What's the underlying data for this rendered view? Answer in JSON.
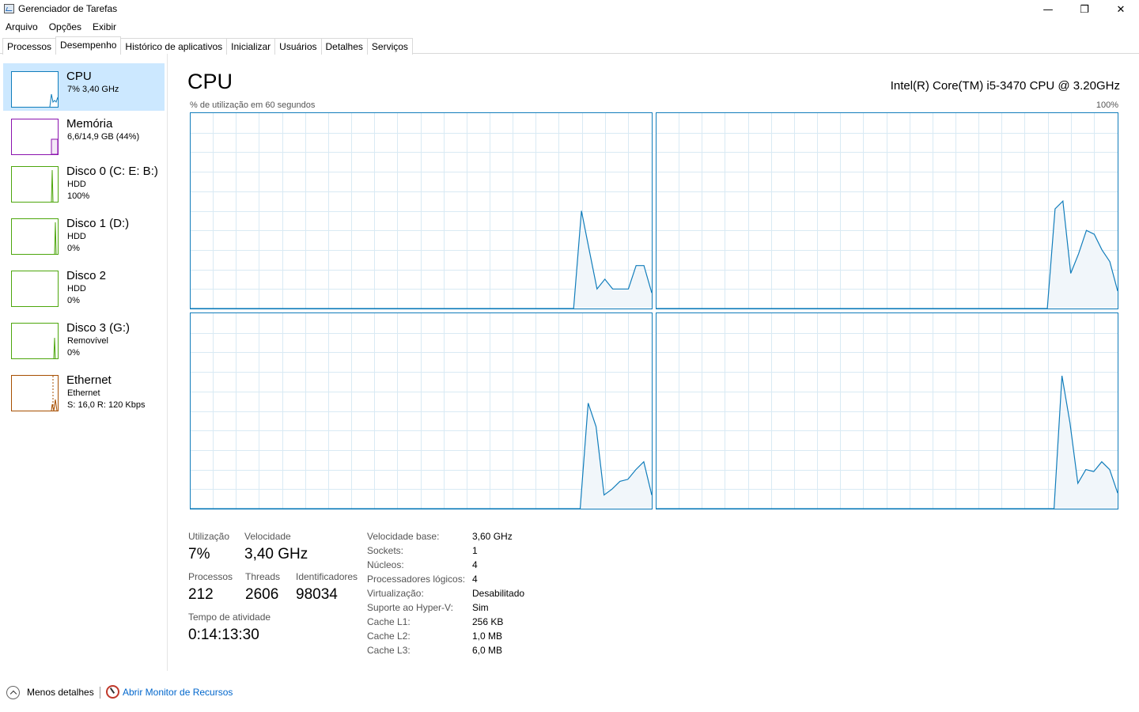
{
  "window": {
    "title": "Gerenciador de Tarefas",
    "minimize_glyph": "—",
    "maximize_glyph": "❐",
    "close_glyph": "✕"
  },
  "menu": [
    "Arquivo",
    "Opções",
    "Exibir"
  ],
  "tabs": [
    "Processos",
    "Desempenho",
    "Histórico de aplicativos",
    "Inicializar",
    "Usuários",
    "Detalhes",
    "Serviços"
  ],
  "active_tab": "Desempenho",
  "sidebar": [
    {
      "title": "CPU",
      "line1": "7% 3,40 GHz",
      "line2": "",
      "color": "#117dbb",
      "selected": true
    },
    {
      "title": "Memória",
      "line1": "6,6/14,9 GB (44%)",
      "line2": "",
      "color": "#8b12ae",
      "selected": false
    },
    {
      "title": "Disco 0 (C: E: B:)",
      "line1": "HDD",
      "line2": "100%",
      "color": "#4da60c",
      "selected": false
    },
    {
      "title": "Disco 1 (D:)",
      "line1": "HDD",
      "line2": "0%",
      "color": "#4da60c",
      "selected": false
    },
    {
      "title": "Disco 2",
      "line1": "HDD",
      "line2": "0%",
      "color": "#4da60c",
      "selected": false
    },
    {
      "title": "Disco 3 (G:)",
      "line1": "Removível",
      "line2": "0%",
      "color": "#4da60c",
      "selected": false
    },
    {
      "title": "Ethernet",
      "line1": "Ethernet",
      "line2": "S: 16,0  R: 120 Kbps",
      "color": "#a74f01",
      "selected": false
    }
  ],
  "main": {
    "title": "CPU",
    "model": "Intel(R) Core(TM) i5-3470 CPU @ 3.20GHz",
    "graph_caption": "% de utilização em 60 segundos",
    "graph_max": "100%"
  },
  "cores_utilization_pct": [
    [
      0,
      0,
      0,
      0,
      0,
      0,
      0,
      0,
      0,
      0,
      0,
      0,
      0,
      0,
      0,
      0,
      0,
      0,
      0,
      0,
      0,
      0,
      0,
      0,
      0,
      0,
      0,
      0,
      0,
      0,
      0,
      0,
      0,
      0,
      0,
      0,
      0,
      0,
      0,
      0,
      0,
      0,
      0,
      0,
      0,
      0,
      0,
      0,
      0,
      0,
      50,
      30,
      10,
      15,
      10,
      10,
      10,
      22,
      22,
      8
    ],
    [
      0,
      0,
      0,
      0,
      0,
      0,
      0,
      0,
      0,
      0,
      0,
      0,
      0,
      0,
      0,
      0,
      0,
      0,
      0,
      0,
      0,
      0,
      0,
      0,
      0,
      0,
      0,
      0,
      0,
      0,
      0,
      0,
      0,
      0,
      0,
      0,
      0,
      0,
      0,
      0,
      0,
      0,
      0,
      0,
      0,
      0,
      0,
      0,
      0,
      0,
      0,
      51,
      55,
      18,
      28,
      40,
      38,
      30,
      24,
      9
    ],
    [
      0,
      0,
      0,
      0,
      0,
      0,
      0,
      0,
      0,
      0,
      0,
      0,
      0,
      0,
      0,
      0,
      0,
      0,
      0,
      0,
      0,
      0,
      0,
      0,
      0,
      0,
      0,
      0,
      0,
      0,
      0,
      0,
      0,
      0,
      0,
      0,
      0,
      0,
      0,
      0,
      0,
      0,
      0,
      0,
      0,
      0,
      0,
      0,
      0,
      0,
      54,
      42,
      7,
      10,
      14,
      15,
      20,
      24,
      7
    ],
    [
      0,
      0,
      0,
      0,
      0,
      0,
      0,
      0,
      0,
      0,
      0,
      0,
      0,
      0,
      0,
      0,
      0,
      0,
      0,
      0,
      0,
      0,
      0,
      0,
      0,
      0,
      0,
      0,
      0,
      0,
      0,
      0,
      0,
      0,
      0,
      0,
      0,
      0,
      0,
      0,
      0,
      0,
      0,
      0,
      0,
      0,
      0,
      0,
      0,
      0,
      0,
      68,
      44,
      13,
      20,
      19,
      24,
      20,
      8
    ]
  ],
  "stats": {
    "utilizacao_label": "Utilização",
    "utilizacao": "7%",
    "velocidade_label": "Velocidade",
    "velocidade": "3,40 GHz",
    "processos_label": "Processos",
    "processos": "212",
    "threads_label": "Threads",
    "threads": "2606",
    "identificadores_label": "Identificadores",
    "identificadores": "98034",
    "tempo_label": "Tempo de atividade",
    "tempo": "0:14:13:30"
  },
  "info": [
    {
      "label": "Velocidade base:",
      "value": "3,60 GHz"
    },
    {
      "label": "Sockets:",
      "value": "1"
    },
    {
      "label": "Núcleos:",
      "value": "4"
    },
    {
      "label": "Processadores lógicos:",
      "value": "4"
    },
    {
      "label": "Virtualização:",
      "value": "Desabilitado"
    },
    {
      "label": "Suporte ao Hyper-V:",
      "value": "Sim"
    },
    {
      "label": "Cache L1:",
      "value": "256 KB"
    },
    {
      "label": "Cache L2:",
      "value": "1,0 MB"
    },
    {
      "label": "Cache L3:",
      "value": "6,0 MB"
    }
  ],
  "footer": {
    "less_details": "Menos detalhes",
    "resource_monitor": "Abrir Monitor de Recursos"
  },
  "colors": {
    "cpu": "#117dbb",
    "grid": "#d9eaf4",
    "fill": "#f1f6fa",
    "selected_bg": "#cce8ff"
  }
}
